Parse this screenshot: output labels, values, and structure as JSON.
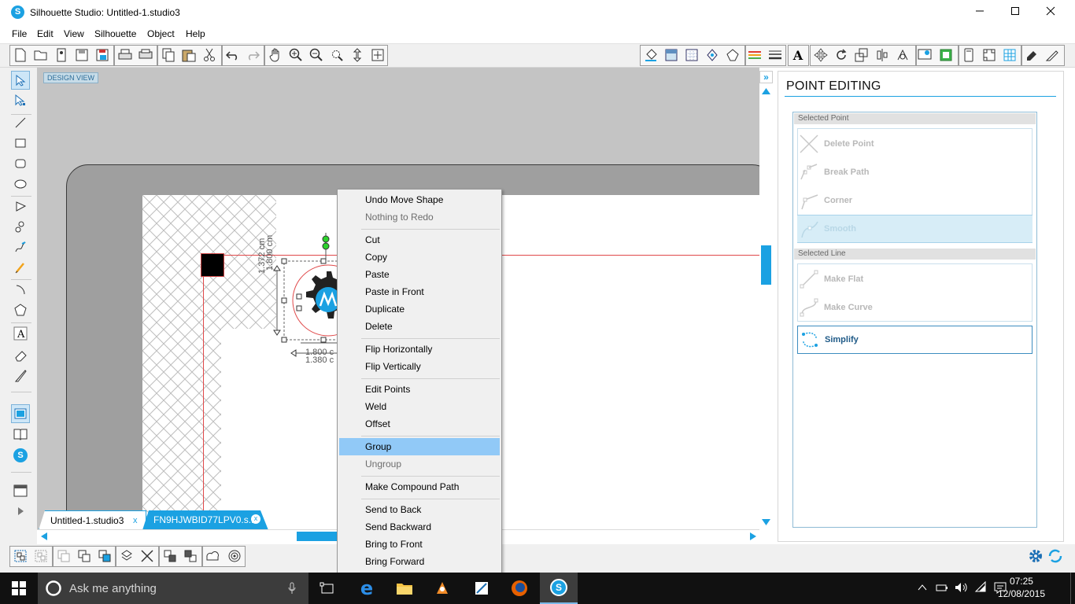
{
  "window": {
    "title": "Silhouette Studio: Untitled-1.studio3",
    "app_icon": "S",
    "minimize": "—",
    "maximize": "☐",
    "close": "✕"
  },
  "menubar": [
    "File",
    "Edit",
    "View",
    "Silhouette",
    "Object",
    "Help"
  ],
  "canvas": {
    "design_view_label": "DESIGN VIEW",
    "dimension_height_1": "1.372 cm",
    "dimension_height_2": "1.800 cm",
    "dimension_width_1": "1.800 c",
    "dimension_width_2": "1.380 c"
  },
  "tabs": [
    {
      "label": "Untitled-1.studio3",
      "close": "x"
    },
    {
      "label": "FN9HJWBID77LPV0.s...",
      "close": "x"
    }
  ],
  "context_menu": {
    "items": [
      {
        "label": "Undo Move Shape",
        "disabled": false
      },
      {
        "label": "Nothing to Redo",
        "disabled": true
      },
      {
        "label": "Cut",
        "disabled": false
      },
      {
        "label": "Copy",
        "disabled": false
      },
      {
        "label": "Paste",
        "disabled": false
      },
      {
        "label": "Paste in Front",
        "disabled": false
      },
      {
        "label": "Duplicate",
        "disabled": false
      },
      {
        "label": "Delete",
        "disabled": false
      },
      {
        "label": "Flip Horizontally",
        "disabled": false
      },
      {
        "label": "Flip Vertically",
        "disabled": false
      },
      {
        "label": "Edit Points",
        "disabled": false
      },
      {
        "label": "Weld",
        "disabled": false
      },
      {
        "label": "Offset",
        "disabled": false
      },
      {
        "label": "Group",
        "disabled": false,
        "highlighted": true
      },
      {
        "label": "Ungroup",
        "disabled": true
      },
      {
        "label": "Make Compound Path",
        "disabled": false
      },
      {
        "label": "Send to Back",
        "disabled": false
      },
      {
        "label": "Send Backward",
        "disabled": false
      },
      {
        "label": "Bring to Front",
        "disabled": false
      },
      {
        "label": "Bring Forward",
        "disabled": false
      }
    ]
  },
  "point_editing": {
    "title": "POINT EDITING",
    "selected_point_label": "Selected Point",
    "selected_line_label": "Selected Line",
    "delete_point": "Delete Point",
    "break_path": "Break Path",
    "corner": "Corner",
    "smooth": "Smooth",
    "make_flat": "Make Flat",
    "make_curve": "Make Curve",
    "simplify": "Simplify"
  },
  "taskbar": {
    "search_placeholder": "Ask me anything",
    "time": "07:25",
    "date": "12/08/2015"
  },
  "colors": {
    "accent": "#1ba1e2",
    "menu_highlight": "#91c9f7",
    "cut_line": "#e0494a",
    "taskbar": "#111111"
  }
}
